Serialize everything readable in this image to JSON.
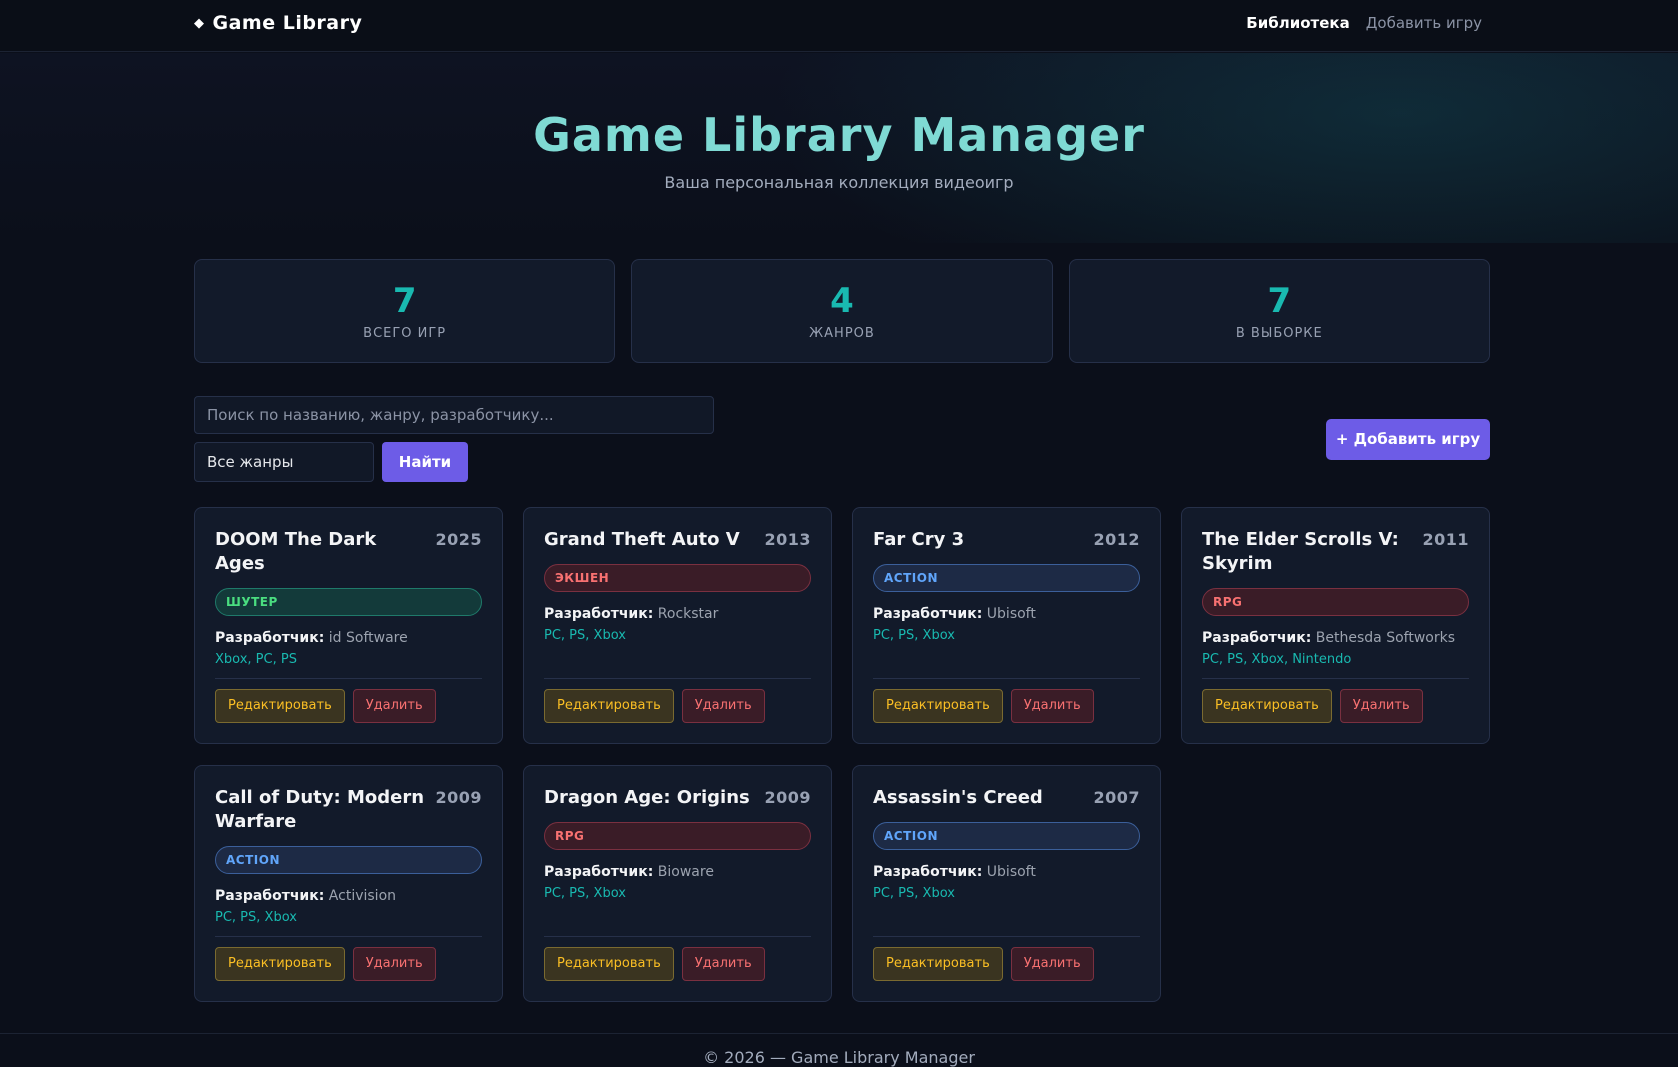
{
  "nav": {
    "brand": "Game Library",
    "links": [
      {
        "label": "Библиотека",
        "active": true
      },
      {
        "label": "Добавить игру",
        "active": false
      }
    ]
  },
  "hero": {
    "title": "Game Library Manager",
    "subtitle": "Ваша персональная коллекция видеоигр"
  },
  "stats": [
    {
      "value": "7",
      "label": "ВСЕГО ИГР"
    },
    {
      "value": "4",
      "label": "ЖАНРОВ"
    },
    {
      "value": "7",
      "label": "В ВЫБОРКЕ"
    }
  ],
  "search": {
    "placeholder": "Поиск по названию, жанру, разработчику...",
    "genre_selected": "Все жанры",
    "find_label": "Найти",
    "add_label": "+ Добавить игру"
  },
  "card_labels": {
    "developer": "Разработчик:",
    "edit": "Редактировать",
    "delete": "Удалить"
  },
  "games": [
    {
      "title": "DOOM The Dark Ages",
      "year": "2025",
      "genre": "ШУТЕР",
      "genre_style": "green",
      "developer": "id Software",
      "platforms": "Xbox, PC, PS"
    },
    {
      "title": "Grand Theft Auto V",
      "year": "2013",
      "genre": "ЭКШЕН",
      "genre_style": "red",
      "developer": "Rockstar",
      "platforms": "PC, PS, Xbox"
    },
    {
      "title": "Far Cry 3",
      "year": "2012",
      "genre": "ACTION",
      "genre_style": "blue",
      "developer": "Ubisoft",
      "platforms": "PC, PS, Xbox"
    },
    {
      "title": "The Elder Scrolls V: Skyrim",
      "year": "2011",
      "genre": "RPG",
      "genre_style": "red",
      "developer": "Bethesda Softworks",
      "platforms": "PC, PS, Xbox, Nintendo"
    },
    {
      "title": "Call of Duty: Modern Warfare",
      "year": "2009",
      "genre": "ACTION",
      "genre_style": "blue",
      "developer": "Activision",
      "platforms": "PC, PS, Xbox"
    },
    {
      "title": "Dragon Age: Origins",
      "year": "2009",
      "genre": "RPG",
      "genre_style": "red",
      "developer": "Bioware",
      "platforms": "PC, PS, Xbox"
    },
    {
      "title": "Assassin's Creed",
      "year": "2007",
      "genre": "ACTION",
      "genre_style": "blue",
      "developer": "Ubisoft",
      "platforms": "PC, PS, Xbox"
    }
  ],
  "footer": "© 2026 — Game Library Manager",
  "colors": {
    "accent": "#6d5ce7",
    "teal": "#19b9b0",
    "title": "#7fdad4",
    "background": "#0b0f1a"
  }
}
